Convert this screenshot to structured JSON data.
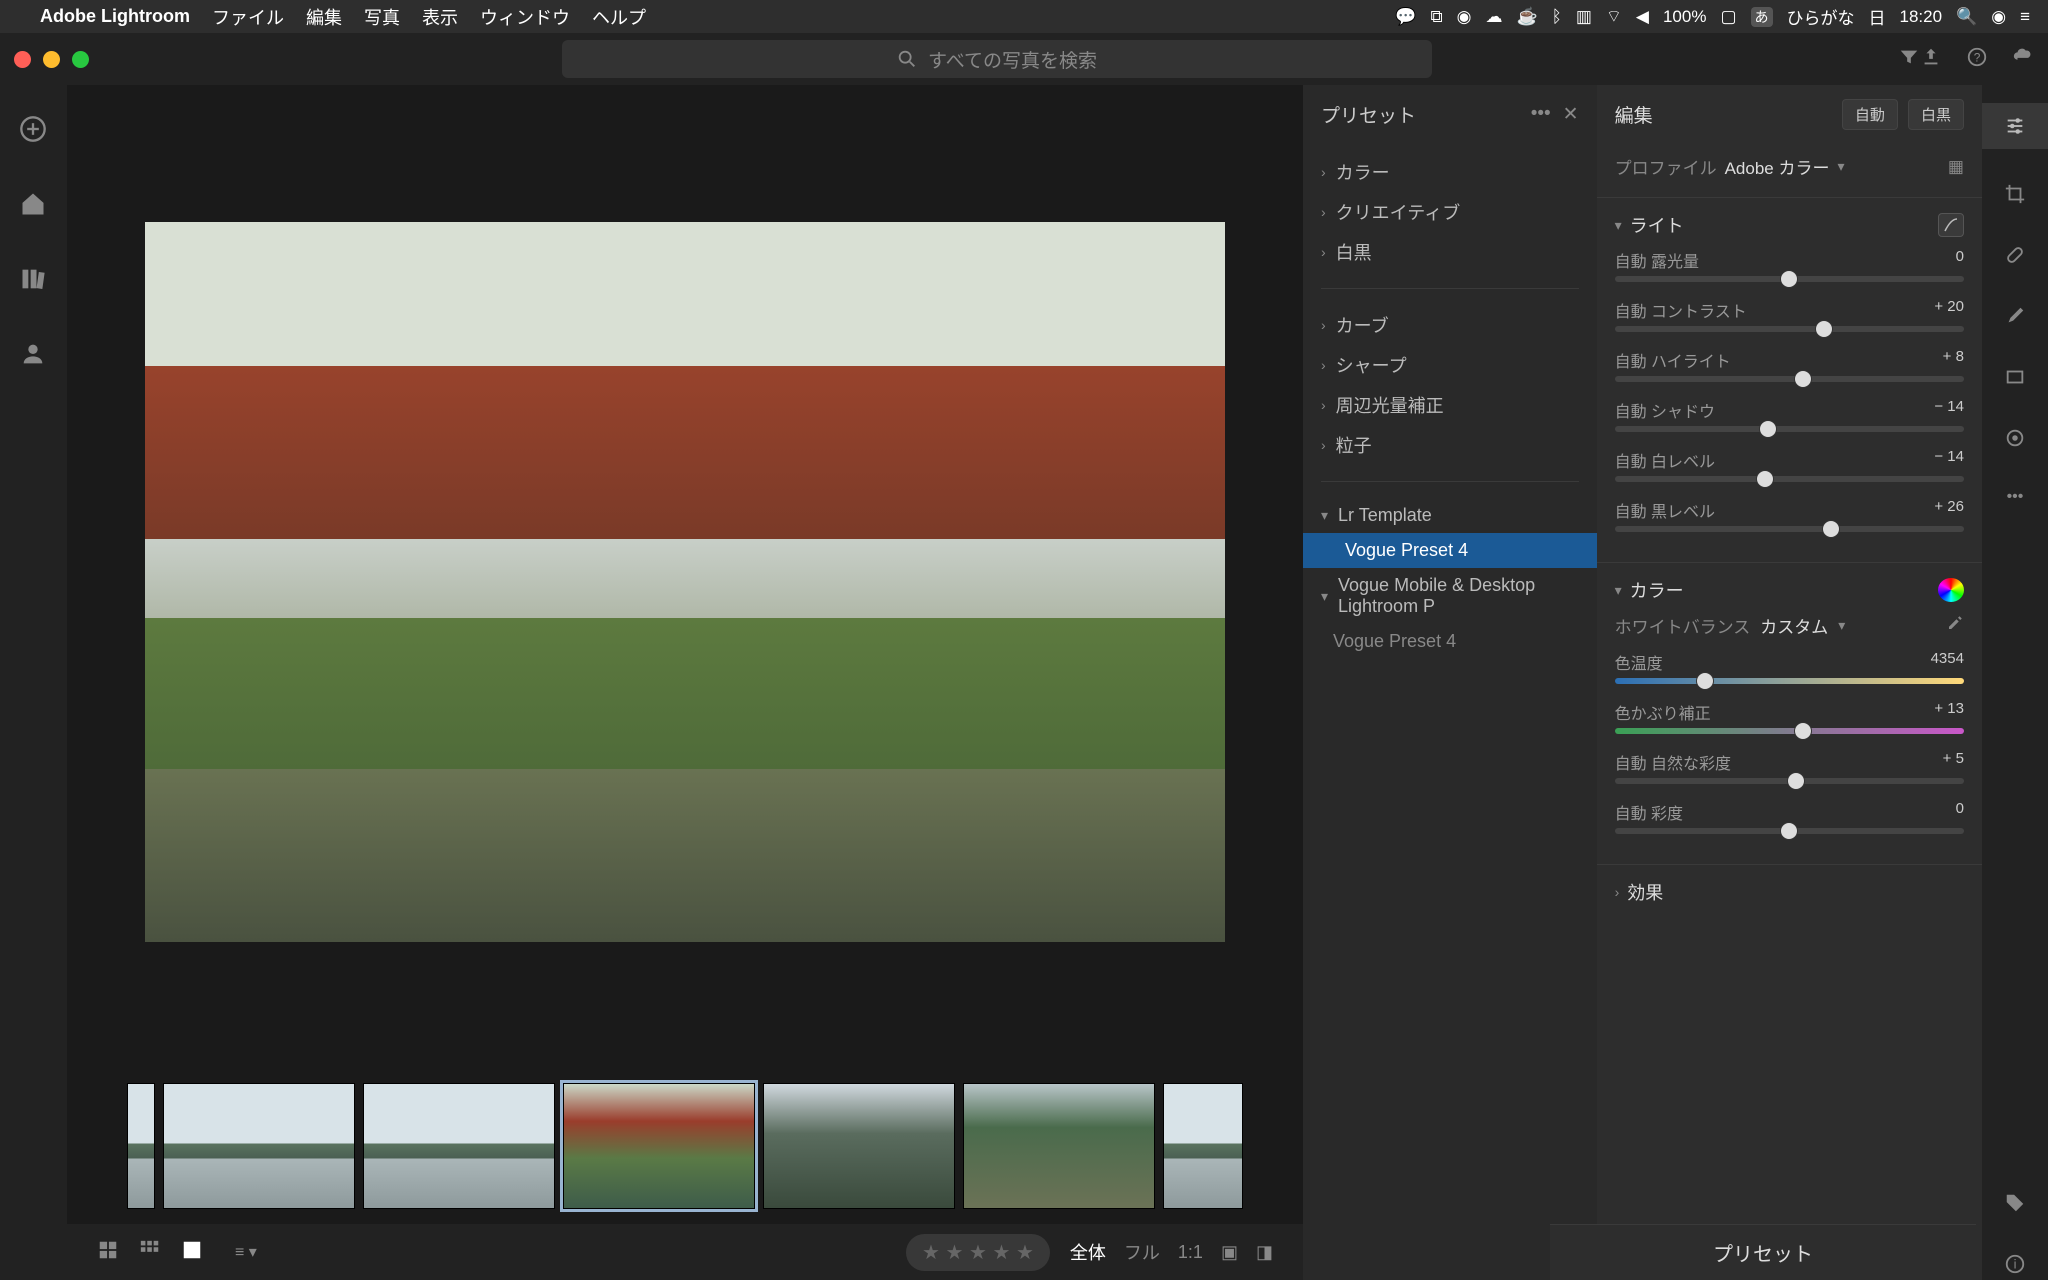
{
  "mac": {
    "app_name": "Adobe Lightroom",
    "menu": [
      "ファイル",
      "編集",
      "写真",
      "表示",
      "ウィンドウ",
      "ヘルプ"
    ],
    "battery": "100%",
    "ime_badge": "あ",
    "ime_label": "ひらがな",
    "day": "日",
    "time": "18:20"
  },
  "search": {
    "placeholder": "すべての写真を検索"
  },
  "presets": {
    "title": "プリセット",
    "groups1": [
      "カラー",
      "クリエイティブ",
      "白黒"
    ],
    "groups2": [
      "カーブ",
      "シャープ",
      "周辺光量補正",
      "粒子"
    ],
    "lr_template": "Lr Template",
    "selected": "Vogue Preset 4",
    "mobile_desktop": "Vogue Mobile & Desktop Lightroom P",
    "child": "Vogue Preset 4"
  },
  "edit": {
    "title": "編集",
    "auto_btn": "自動",
    "bw_btn": "白黒",
    "profile_label": "プロファイル",
    "profile_value": "Adobe カラー",
    "light": {
      "title": "ライト",
      "sliders": [
        {
          "label": "自動 露光量",
          "value": "0",
          "pos": 50
        },
        {
          "label": "自動 コントラスト",
          "value": "+ 20",
          "pos": 60
        },
        {
          "label": "自動 ハイライト",
          "value": "+ 8",
          "pos": 54
        },
        {
          "label": "自動 シャドウ",
          "value": "− 14",
          "pos": 44
        },
        {
          "label": "自動 白レベル",
          "value": "− 14",
          "pos": 43
        },
        {
          "label": "自動 黒レベル",
          "value": "+ 26",
          "pos": 62
        }
      ]
    },
    "color": {
      "title": "カラー",
      "wb_label": "ホワイトバランス",
      "wb_value": "カスタム",
      "sliders": [
        {
          "label": "色温度",
          "value": "4354",
          "pos": 26,
          "cls": "temp"
        },
        {
          "label": "色かぶり補正",
          "value": "+ 13",
          "pos": 54,
          "cls": "tint"
        },
        {
          "label": "自動 自然な彩度",
          "value": "+ 5",
          "pos": 52,
          "cls": ""
        },
        {
          "label": "自動 彩度",
          "value": "0",
          "pos": 50,
          "cls": ""
        }
      ]
    },
    "effects_title": "効果",
    "presets_btn": "プリセット"
  },
  "bottom": {
    "zoom": [
      "全体",
      "フル",
      "1:1"
    ]
  }
}
